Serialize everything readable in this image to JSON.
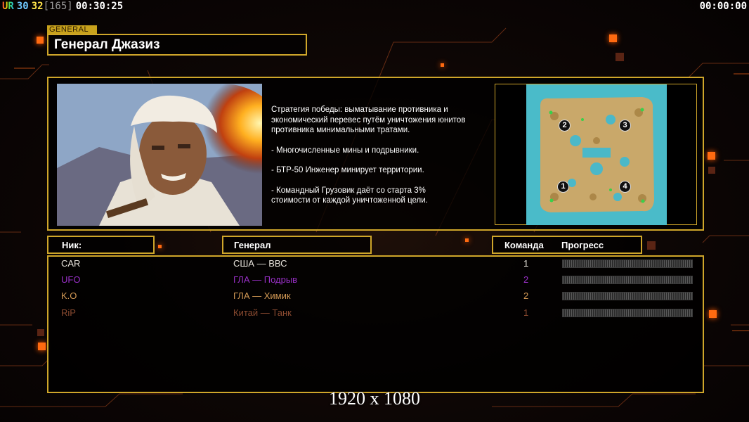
{
  "hud": {
    "ur": "UR",
    "count_a": "30",
    "count_b": "32",
    "bracket": "[165]",
    "elapsed": "00:30:25",
    "clock": "00:00:00"
  },
  "header": {
    "tag": "GENERAL",
    "title": "Генерал Джазиз"
  },
  "info": {
    "description": [
      "Стратегия победы: выматывание противника и\n экономический перевес путём уничтожения юнитов\n противника минимальными тратами.",
      "- Многочисленные мины и подрывники.",
      "- БТР-50 Инженер минирует территории.",
      "- Командный Грузовик даёт со старта 3%\n стоимости от каждой уничтоженной цели."
    ],
    "map_slots": [
      "1",
      "2",
      "3",
      "4"
    ]
  },
  "columns": {
    "nick": "Ник:",
    "general": "Генерал",
    "team": "Команда",
    "progress": "Прогресс"
  },
  "players": [
    {
      "nick": "CAR",
      "general": "США — ВВС",
      "team": "1",
      "color": "#e8e4dc",
      "progress": 0
    },
    {
      "nick": "UFO",
      "general": "ГЛА — Подрыв",
      "team": "2",
      "color": "#9a30c8",
      "progress": 0
    },
    {
      "nick": "K.O",
      "general": "ГЛА — Химик",
      "team": "2",
      "color": "#d49a55",
      "progress": 0
    },
    {
      "nick": "RiP",
      "general": "Китай — Танк",
      "team": "1",
      "color": "#8a4a30",
      "progress": 0
    }
  ],
  "resolution": "1920 x 1080",
  "colors": {
    "accent_gold": "#cfa62a",
    "glow_orange": "#ff6a10"
  }
}
